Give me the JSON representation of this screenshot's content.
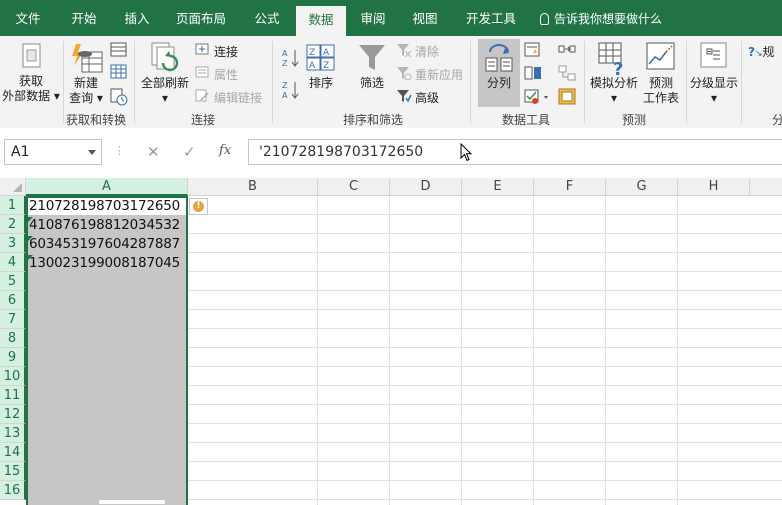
{
  "tabs": [
    "文件",
    "开始",
    "插入",
    "页面布局",
    "公式",
    "数据",
    "审阅",
    "视图",
    "开发工具"
  ],
  "active_tab": "数据",
  "tell_me": "告诉我你想要做什么",
  "ribbon": {
    "get_external_line1": "获取",
    "get_external_line2": "外部数据",
    "new_query_line1": "新建",
    "new_query_line2": "查询",
    "refresh_all": "全部刷新",
    "connections": "连接",
    "properties": "属性",
    "edit_links": "编辑链接",
    "sort_az": "A↓Z",
    "sort_za": "Z↓A",
    "sort": "排序",
    "filter": "筛选",
    "clear": "清除",
    "reapply": "重新应用",
    "advanced": "高级",
    "text_to_columns": "分列",
    "what_if_line1": "模拟分析",
    "forecast_line1": "预测",
    "forecast_line2": "工作表",
    "outline": "分级显示",
    "solver_partial": "规",
    "groups": {
      "get_transform": "获取和转换",
      "connections": "连接",
      "sort_filter": "排序和筛选",
      "data_tools": "数据工具",
      "forecast": "预测",
      "partial": "分"
    }
  },
  "formula_bar": {
    "name_box": "A1",
    "cancel": "✕",
    "confirm": "✓",
    "fx": "fx",
    "formula": "'210728198703172650"
  },
  "columns": [
    "A",
    "B",
    "C",
    "D",
    "E",
    "F",
    "G",
    "H"
  ],
  "rows": [
    "1",
    "2",
    "3",
    "4",
    "5",
    "6",
    "7",
    "8",
    "9",
    "10",
    "11",
    "12",
    "13",
    "14",
    "15",
    "16"
  ],
  "cells_A": [
    "210728198703172650",
    "410876198812034532",
    "603453197604287887",
    "130023199008187045"
  ],
  "colors": {
    "accent": "#217346",
    "selection": "#c6c6c6"
  }
}
